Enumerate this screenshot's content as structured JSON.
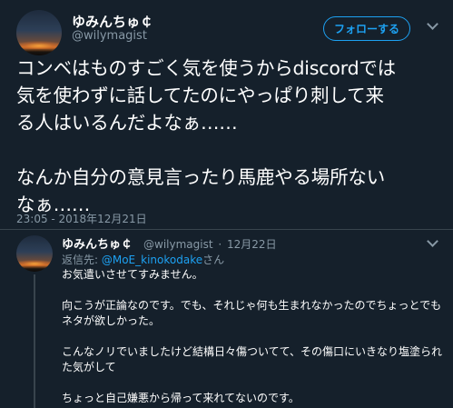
{
  "tweet": {
    "display_name": "ゆみんちゅ￠",
    "handle": "@wilymagist",
    "follow_label": "フォローする",
    "text": "コンベはものすごく気を使うからdiscordでは\n気を使わずに話してたのにやっぱり刺して来\nる人はいるんだよなぁ……\n\nなんか自分の意見言ったり馬鹿やる場所ない\nなぁ……",
    "timestamp": "23:05 - 2018年12月21日"
  },
  "reply": {
    "display_name": "ゆみんちゅ￠",
    "handle": "@wilymagist",
    "separator": "·",
    "date": "12月22日",
    "reply_to_prefix": "返信先: ",
    "reply_to_mention": "@MoE_kinokodake",
    "reply_to_suffix": "さん",
    "paragraphs": [
      "お気遣いさせてすみません。",
      "向こうが正論なのです。でも、それじゃ何も生まれなかったのでちょっとでもネタが欲しかった。",
      "こんなノリでいましたけど結構日々傷ついてて、その傷口にいきなり塩塗られた気がして",
      "ちょっと自己嫌悪から帰って来れてないのです。"
    ]
  },
  "icons": {
    "menu": "chevron-down-icon",
    "avatar": "sunset-photo"
  },
  "colors": {
    "background": "#15202b",
    "accent": "#1da1f2",
    "secondary_text": "#8899a6",
    "divider": "#38444d"
  }
}
